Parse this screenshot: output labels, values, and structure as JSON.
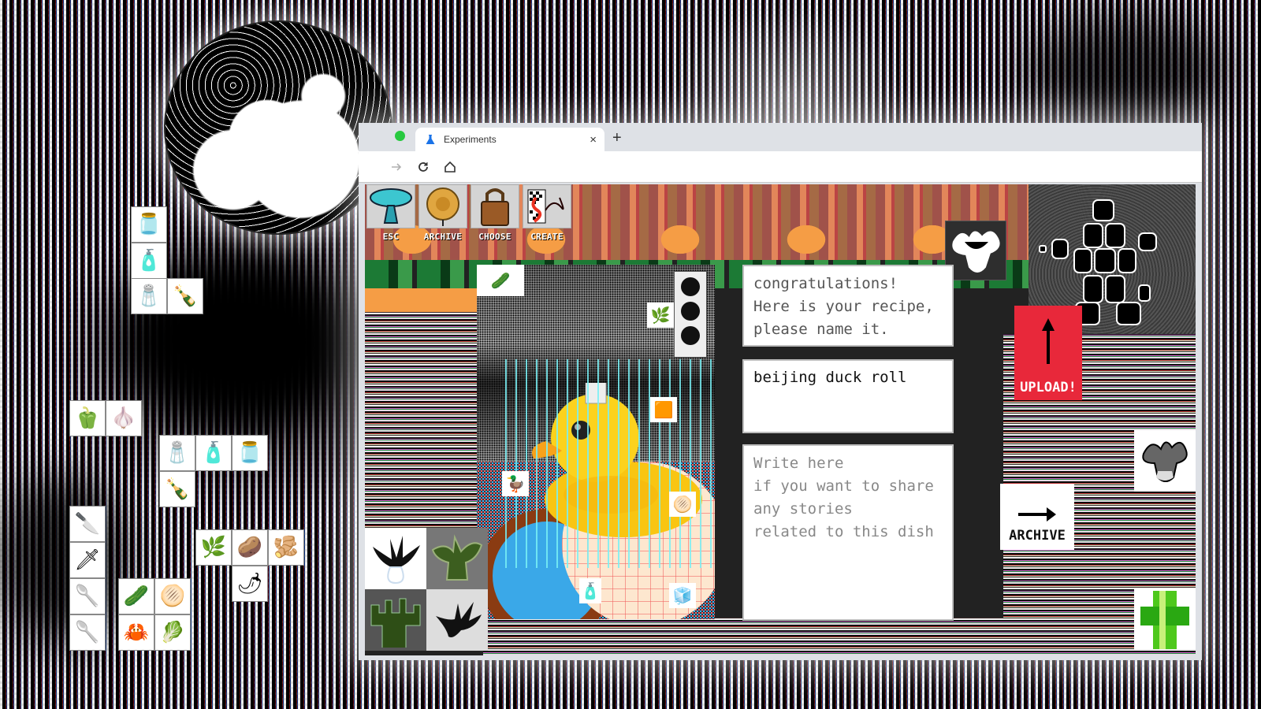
{
  "browser": {
    "tab_title": "Experiments",
    "tab_icon": "flask-icon",
    "new_tab_label": "+",
    "close_tab_label": "×",
    "traffic_light_color": "#28c940"
  },
  "app": {
    "nav": [
      {
        "label": "ESC",
        "icon": "lamp-icon"
      },
      {
        "label": "ARCHIVE",
        "icon": "mooncake-icon"
      },
      {
        "label": "CHOOSE",
        "icon": "padlock-icon"
      },
      {
        "label": "CREATE",
        "icon": "dragon-card-icon"
      }
    ],
    "congrats_lines": [
      "congratulations!",
      "Here is your recipe,",
      "please name it."
    ],
    "recipe_name": "beijing duck roll",
    "story_placeholder_lines": [
      "Write here",
      "if you want to share",
      "any stories",
      "related to this dish"
    ],
    "upload_label": "UPLOAD!",
    "archive_label": "ARCHIVE",
    "colors": {
      "upload_red": "#e8283a",
      "accent_orange": "#f59d45",
      "duck_yellow": "#f9c512",
      "line_cyan": "#78f0f5"
    }
  },
  "collage_ingredients": [
    "cucumber",
    "scallion",
    "duck",
    "pancake",
    "oil-bottle",
    "sugar-cubes",
    "oven",
    "cleaver"
  ],
  "floating_ingredients": [
    "sauce-jar",
    "oil-bottle",
    "salt-bag",
    "soy-sauce-bottle",
    "green-peppers",
    "garlic",
    "salt-bag",
    "oil-bottle",
    "sauce-jar",
    "soy-sauce-bottle",
    "cleaver",
    "cleaver-blade",
    "scallion",
    "potato",
    "ginger",
    "spatula",
    "cucumber",
    "pancake",
    "red-chili",
    "ladle",
    "crab",
    "bok-choy"
  ]
}
